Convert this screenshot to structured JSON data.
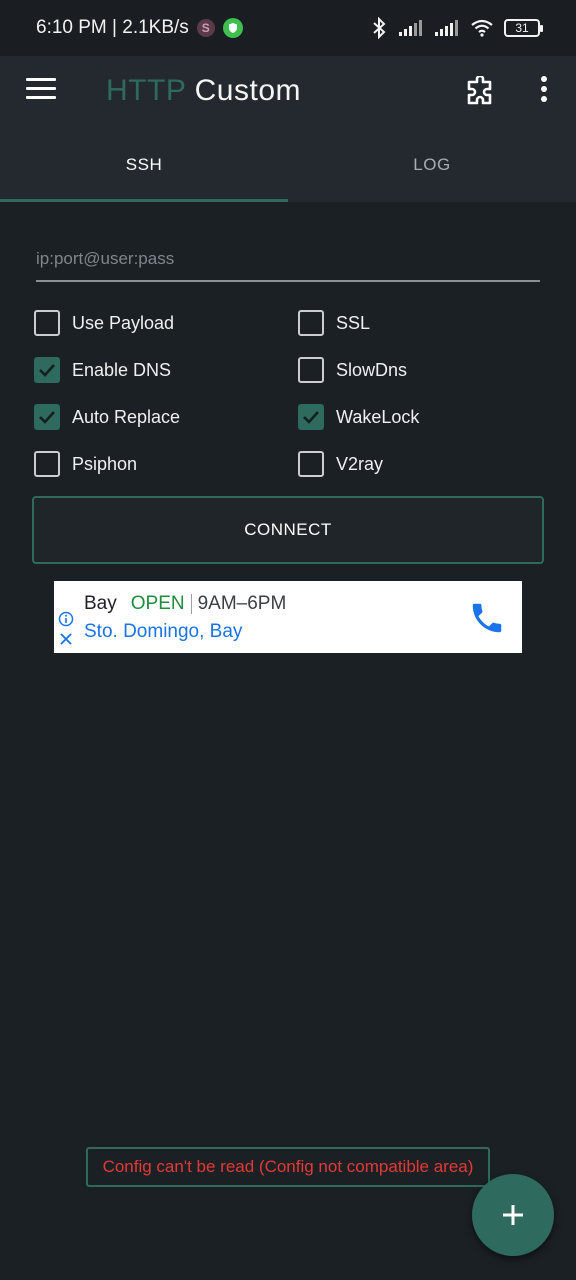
{
  "status_bar": {
    "time_speed": "6:10 PM | 2.1KB/s",
    "s_badge": "S",
    "battery": "31",
    "icons": [
      "bluetooth-icon",
      "signal-icon",
      "signal-icon",
      "wifi-icon",
      "battery-icon"
    ]
  },
  "app_bar": {
    "title_part1": "HTTP",
    "title_part2": "Custom",
    "icons": [
      "menu-icon",
      "puzzle-icon",
      "more-vert-icon"
    ]
  },
  "tabs": [
    {
      "label": "SSH",
      "active": true
    },
    {
      "label": "LOG",
      "active": false
    }
  ],
  "server_input": {
    "value": "",
    "placeholder": "ip:port@user:pass"
  },
  "options": [
    {
      "label": "Use Payload",
      "checked": false
    },
    {
      "label": "SSL",
      "checked": false
    },
    {
      "label": "Enable DNS",
      "checked": true
    },
    {
      "label": "SlowDns",
      "checked": false
    },
    {
      "label": "Auto Replace",
      "checked": true
    },
    {
      "label": "WakeLock",
      "checked": true
    },
    {
      "label": "Psiphon",
      "checked": false
    },
    {
      "label": "V2ray",
      "checked": false
    }
  ],
  "connect_label": "CONNECT",
  "ad": {
    "name": "Bay",
    "open": "OPEN",
    "hours": "9AM–6PM",
    "location": "Sto. Domingo, Bay"
  },
  "toast": "Config can't be read (Config not compatible area)",
  "colors": {
    "accent": "#2f6a5e",
    "background": "#1b2024",
    "toolbar": "#23292e",
    "error": "#e53935"
  }
}
